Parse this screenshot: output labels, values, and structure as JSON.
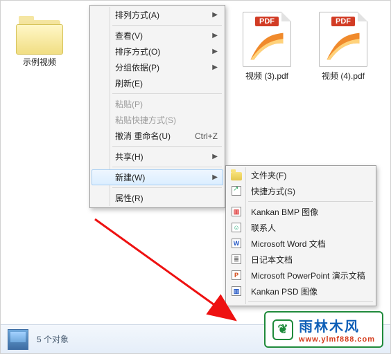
{
  "items": {
    "folder": {
      "label": "示例视频"
    },
    "pdf1": {
      "label": "视频 (3).pdf",
      "badge": "PDF"
    },
    "pdf2": {
      "label": "视频 (4).pdf",
      "badge": "PDF"
    }
  },
  "menu1": {
    "arrange": "排列方式(A)",
    "view": "查看(V)",
    "sort": "排序方式(O)",
    "group": "分组依据(P)",
    "refresh": "刷新(E)",
    "paste": "粘贴(P)",
    "paste_shortcut": "粘贴快捷方式(S)",
    "undo_rename": "撤消 重命名(U)",
    "undo_key": "Ctrl+Z",
    "share": "共享(H)",
    "new": "新建(W)",
    "properties": "属性(R)"
  },
  "menu2": {
    "folder": "文件夹(F)",
    "shortcut": "快捷方式(S)",
    "bmp": "Kankan BMP 图像",
    "contact": "联系人",
    "word": "Microsoft Word 文档",
    "journal": "日记本文档",
    "ppt": "Microsoft PowerPoint 演示文稿",
    "psd": "Kankan PSD 图像"
  },
  "status": {
    "text": "5 个对象"
  },
  "watermark": {
    "cn": "雨林木风",
    "en": "www.ylmf888.com"
  }
}
